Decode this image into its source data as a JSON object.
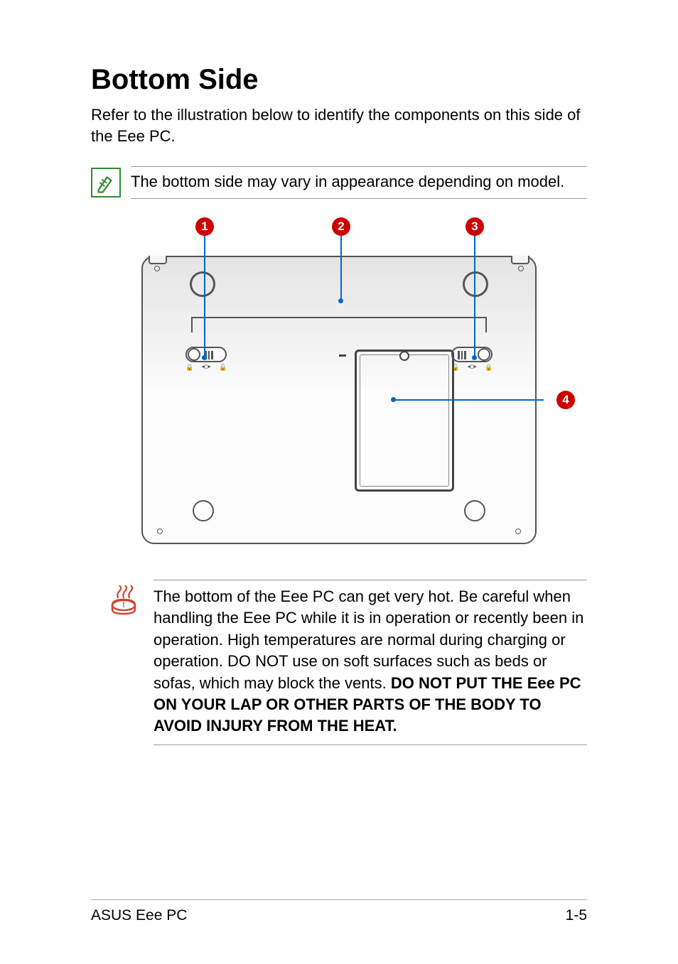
{
  "title": "Bottom Side",
  "intro": "Refer to the illustration below to identify the components on this side of the Eee PC.",
  "note": {
    "text": "The bottom side may vary in appearance depending on model."
  },
  "callouts": {
    "c1": "1",
    "c2": "2",
    "c3": "3",
    "c4": "4"
  },
  "lock_labels": {
    "left_group": "◂▢▸",
    "right_group": "◂▢▸"
  },
  "warning": {
    "text_part1": "The bottom of the Eee PC can get very hot. Be careful when handling the Eee PC while it is in operation or recently been in operation. High temperatures are normal during charging or operation. DO NOT use on soft surfaces such as beds or sofas, which may block the vents. ",
    "text_bold": "DO NOT PUT THE Eee PC ON YOUR LAP OR OTHER PARTS OF THE BODY TO AVOID INJURY FROM THE HEAT."
  },
  "footer": {
    "left": "ASUS Eee PC",
    "right": "1-5"
  }
}
